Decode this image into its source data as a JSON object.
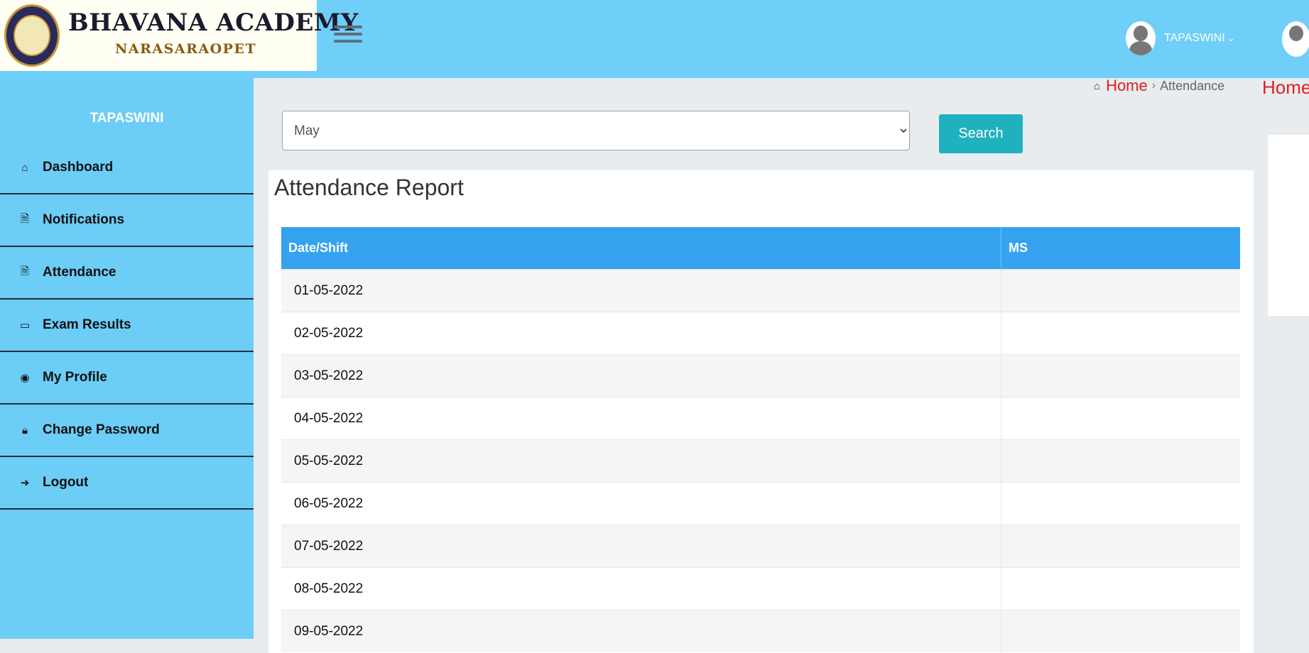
{
  "header": {
    "logo_title": "BHAVANA ACADEMY",
    "logo_subtitle": "NARASARAOPET",
    "user_name": "TAPASWINI"
  },
  "sidebar": {
    "user_name": "TAPASWINI",
    "items": [
      {
        "label": "Dashboard",
        "icon": "home-icon"
      },
      {
        "label": "Notifications",
        "icon": "document-icon"
      },
      {
        "label": "Attendance",
        "icon": "document-icon"
      },
      {
        "label": "Exam Results",
        "icon": "laptop-icon"
      },
      {
        "label": "My Profile",
        "icon": "user-circle-icon"
      },
      {
        "label": "Change Password",
        "icon": "lock-icon"
      },
      {
        "label": "Logout",
        "icon": "sign-out-icon"
      }
    ]
  },
  "breadcrumb": {
    "home": "Home",
    "separator": "›",
    "current": "Attendance"
  },
  "filter": {
    "month_selected": "May",
    "search_label": "Search"
  },
  "report": {
    "title": "Attendance Report",
    "columns": [
      "Date/Shift",
      "MS"
    ],
    "rows": [
      {
        "date": "01-05-2022",
        "ms": ""
      },
      {
        "date": "02-05-2022",
        "ms": ""
      },
      {
        "date": "03-05-2022",
        "ms": ""
      },
      {
        "date": "04-05-2022",
        "ms": ""
      },
      {
        "date": "05-05-2022",
        "ms": ""
      },
      {
        "date": "06-05-2022",
        "ms": ""
      },
      {
        "date": "07-05-2022",
        "ms": ""
      },
      {
        "date": "08-05-2022",
        "ms": ""
      },
      {
        "date": "09-05-2022",
        "ms": ""
      }
    ]
  },
  "right_panel": {
    "home_fragment": "Home"
  },
  "colors": {
    "header_bg": "#70cff8",
    "sidebar_bg": "#6ccdf7",
    "table_header_bg": "#35a2f0",
    "search_button_bg": "#20b1c0",
    "breadcrumb_link": "#e02020"
  }
}
